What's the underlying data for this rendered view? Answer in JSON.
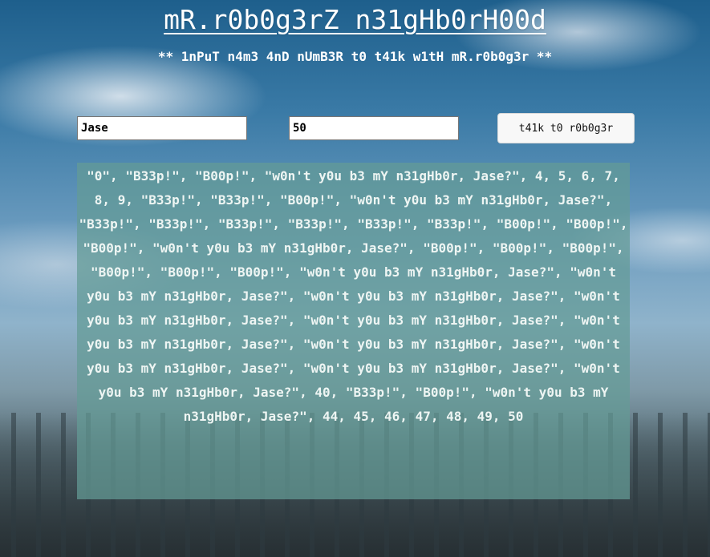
{
  "page": {
    "title": "mR.r0b0g3rZ n31gHb0rH00d",
    "subtitle": "** 1nPuT n4m3 4nD nUmB3R t0 t41k w1tH mR.r0b0g3r **"
  },
  "form": {
    "name_value": "Jase",
    "number_value": "50",
    "talk_button_label": "t41k t0 r0b0g3r"
  },
  "output": {
    "text": "\"0\", \"B33p!\", \"B00p!\", \"w0n't y0u b3 mY n31gHb0r, Jase?\", 4, 5, 6, 7, 8, 9, \"B33p!\", \"B33p!\", \"B00p!\", \"w0n't y0u b3 mY n31gHb0r, Jase?\", \"B33p!\", \"B33p!\", \"B33p!\", \"B33p!\", \"B33p!\", \"B33p!\", \"B00p!\", \"B00p!\", \"B00p!\", \"w0n't y0u b3 mY n31gHb0r, Jase?\", \"B00p!\", \"B00p!\", \"B00p!\", \"B00p!\", \"B00p!\", \"B00p!\", \"w0n't y0u b3 mY n31gHb0r, Jase?\", \"w0n't y0u b3 mY n31gHb0r, Jase?\", \"w0n't y0u b3 mY n31gHb0r, Jase?\", \"w0n't y0u b3 mY n31gHb0r, Jase?\", \"w0n't y0u b3 mY n31gHb0r, Jase?\", \"w0n't y0u b3 mY n31gHb0r, Jase?\", \"w0n't y0u b3 mY n31gHb0r, Jase?\", \"w0n't y0u b3 mY n31gHb0r, Jase?\", \"w0n't y0u b3 mY n31gHb0r, Jase?\", \"w0n't y0u b3 mY n31gHb0r, Jase?\", 40, \"B33p!\", \"B00p!\", \"w0n't y0u b3 mY n31gHb0r, Jase?\", 44, 45, 46, 47, 48, 49, 50"
  },
  "colors": {
    "output_panel": "#649b96",
    "title_text": "#ffffff"
  }
}
